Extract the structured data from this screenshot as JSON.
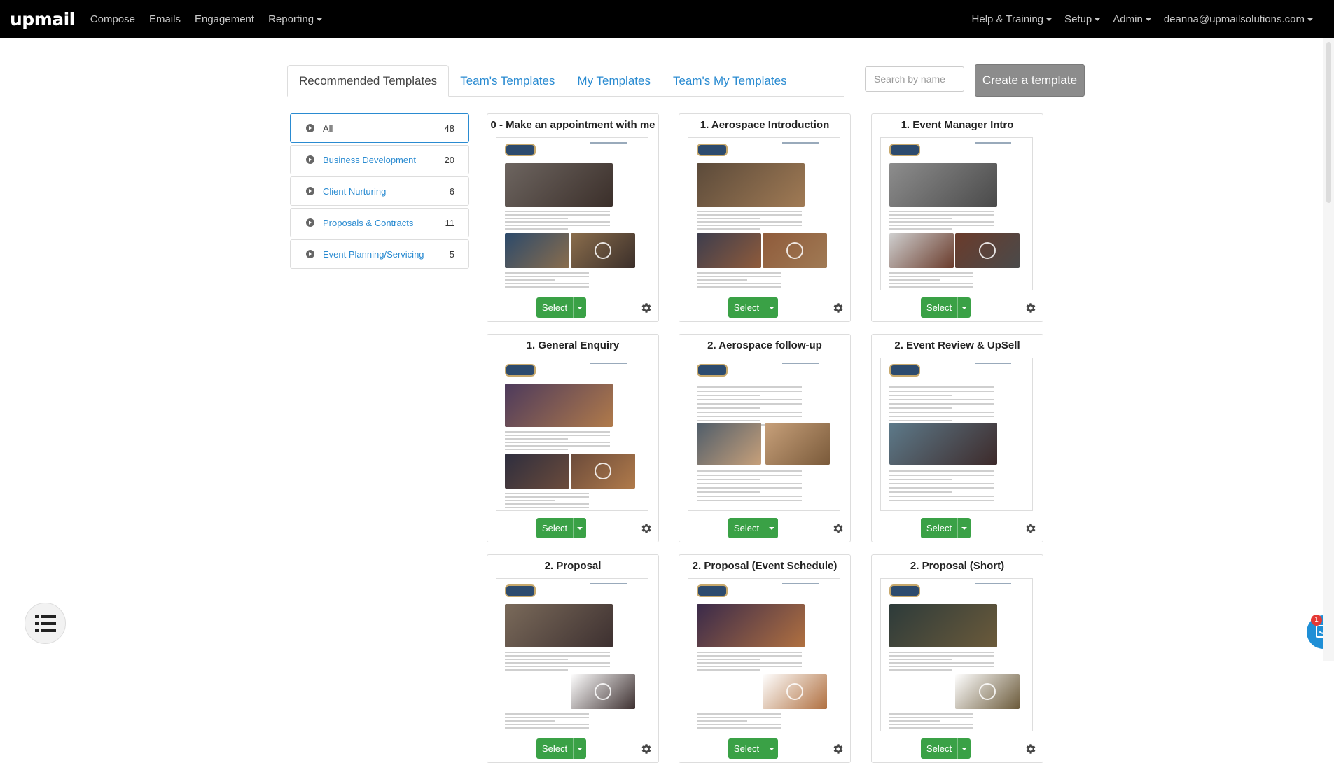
{
  "navbar": {
    "logo": "upmail",
    "left_links": [
      "Compose",
      "Emails",
      "Engagement",
      "Reporting"
    ],
    "right_links": [
      "Help & Training",
      "Setup",
      "Admin",
      "deanna@upmailsolutions.com"
    ]
  },
  "tabs": [
    "Recommended Templates",
    "Team's Templates",
    "My Templates",
    "Team's My Templates"
  ],
  "active_tab": "Recommended Templates",
  "search": {
    "placeholder": "Search by name"
  },
  "create_button": "Create a template",
  "categories": [
    {
      "label": "All",
      "count": "48",
      "active": true
    },
    {
      "label": "Business Development",
      "count": "20"
    },
    {
      "label": "Client Nurturing",
      "count": "6"
    },
    {
      "label": "Proposals & Contracts",
      "count": "11"
    },
    {
      "label": "Event Planning/Servicing",
      "count": "5"
    }
  ],
  "templates": [
    {
      "title": "0 - Make an appointment with me",
      "select_label": "Select"
    },
    {
      "title": "1. Aerospace Introduction",
      "select_label": "Select"
    },
    {
      "title": "1. Event Manager Intro",
      "select_label": "Select"
    },
    {
      "title": "1. General Enquiry",
      "select_label": "Select"
    },
    {
      "title": "2. Aerospace follow-up",
      "select_label": "Select"
    },
    {
      "title": "2. Event Review & UpSell",
      "select_label": "Select"
    },
    {
      "title": "2. Proposal",
      "select_label": "Select"
    },
    {
      "title": "2. Proposal (Event Schedule)",
      "select_label": "Select"
    },
    {
      "title": "2. Proposal (Short)",
      "select_label": "Select"
    }
  ],
  "chat": {
    "badge_count": "1"
  },
  "colors": {
    "link": "#2a8bd1",
    "select_green": "#3aa146",
    "navbar": "#000000",
    "create_button": "#8c8c8c"
  }
}
